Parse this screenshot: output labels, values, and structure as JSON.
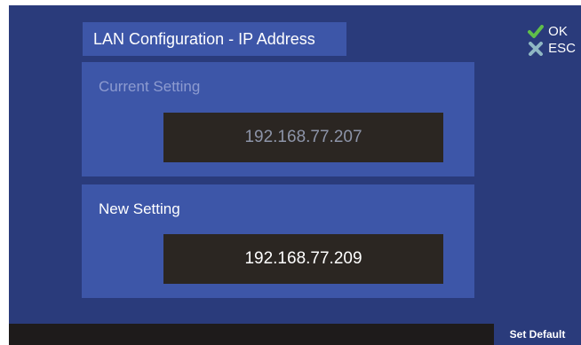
{
  "header": {
    "title": "LAN Configuration - IP Address"
  },
  "actions": {
    "ok_label": "OK",
    "esc_label": "ESC",
    "ok_icon": "check-icon",
    "esc_icon": "close-icon",
    "ok_color": "#5fbf4a",
    "esc_color": "#8fb7c4"
  },
  "current_setting": {
    "label": "Current Setting",
    "value": "192.168.77.207"
  },
  "new_setting": {
    "label": "New Setting",
    "value": "192.168.77.209"
  },
  "footer": {
    "set_default_label": "Set Default"
  },
  "colors": {
    "background": "#2a3b7b",
    "panel": "#3d56a8",
    "field": "#2b2622",
    "footer": "#1e1b1b"
  }
}
